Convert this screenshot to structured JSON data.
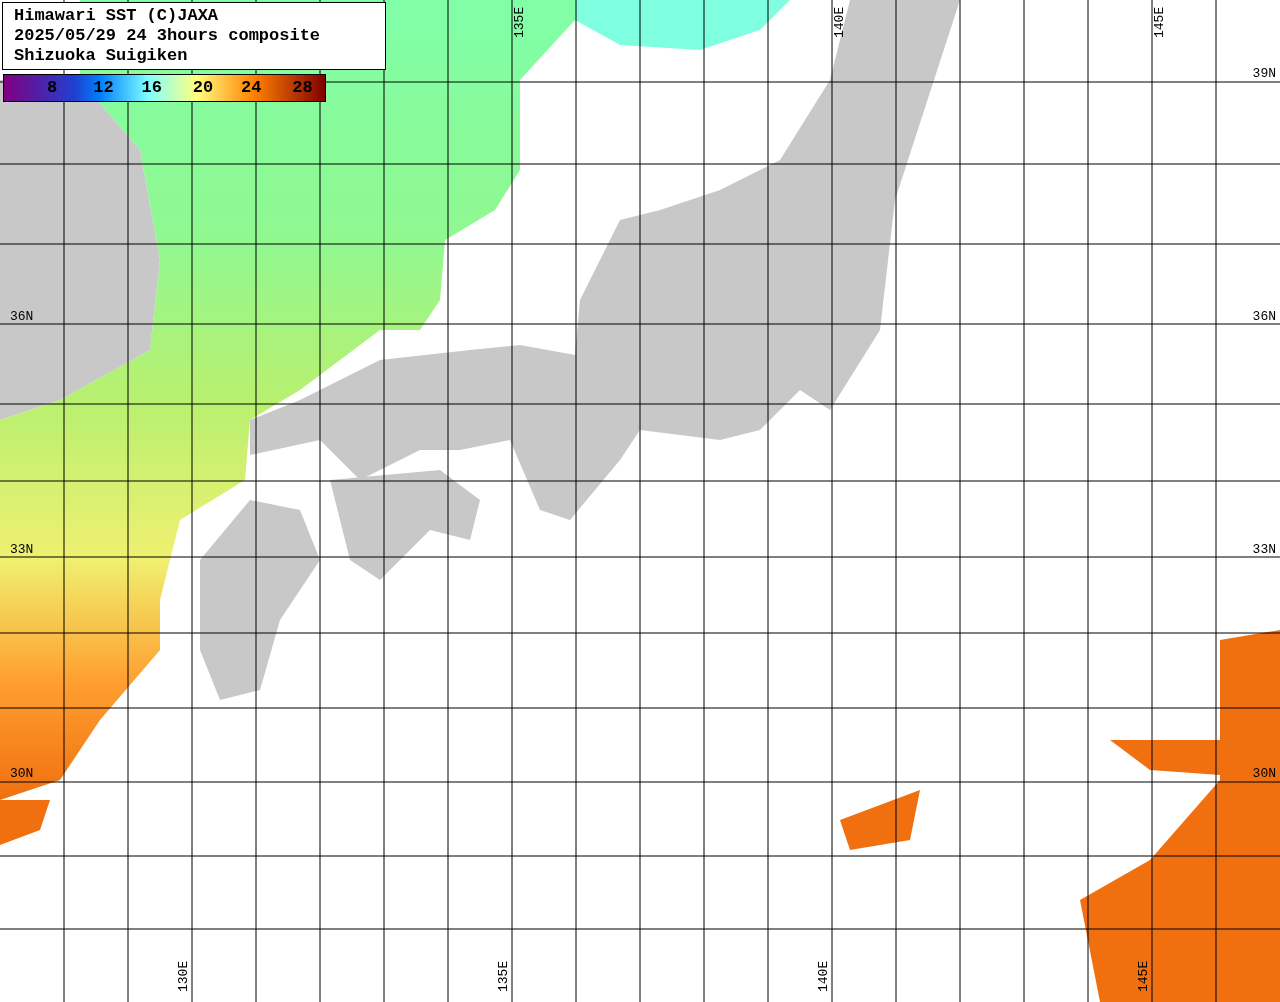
{
  "header": {
    "lines": [
      "Himawari SST (C)JAXA",
      "2025/05/29 24 3hours composite",
      "Shizuoka Suigiken"
    ]
  },
  "color_scale": {
    "labels": [
      "8",
      "12",
      "16",
      "20",
      "24",
      "28"
    ]
  },
  "longitude_labels": {
    "top": [
      "135E",
      "140E",
      "145E"
    ],
    "bottom": [
      "130E",
      "135E",
      "140E",
      "145E"
    ]
  },
  "latitude_labels": {
    "left": [
      "36N",
      "33N",
      "30N"
    ],
    "right": [
      "39N",
      "36N",
      "33N",
      "30N"
    ]
  }
}
